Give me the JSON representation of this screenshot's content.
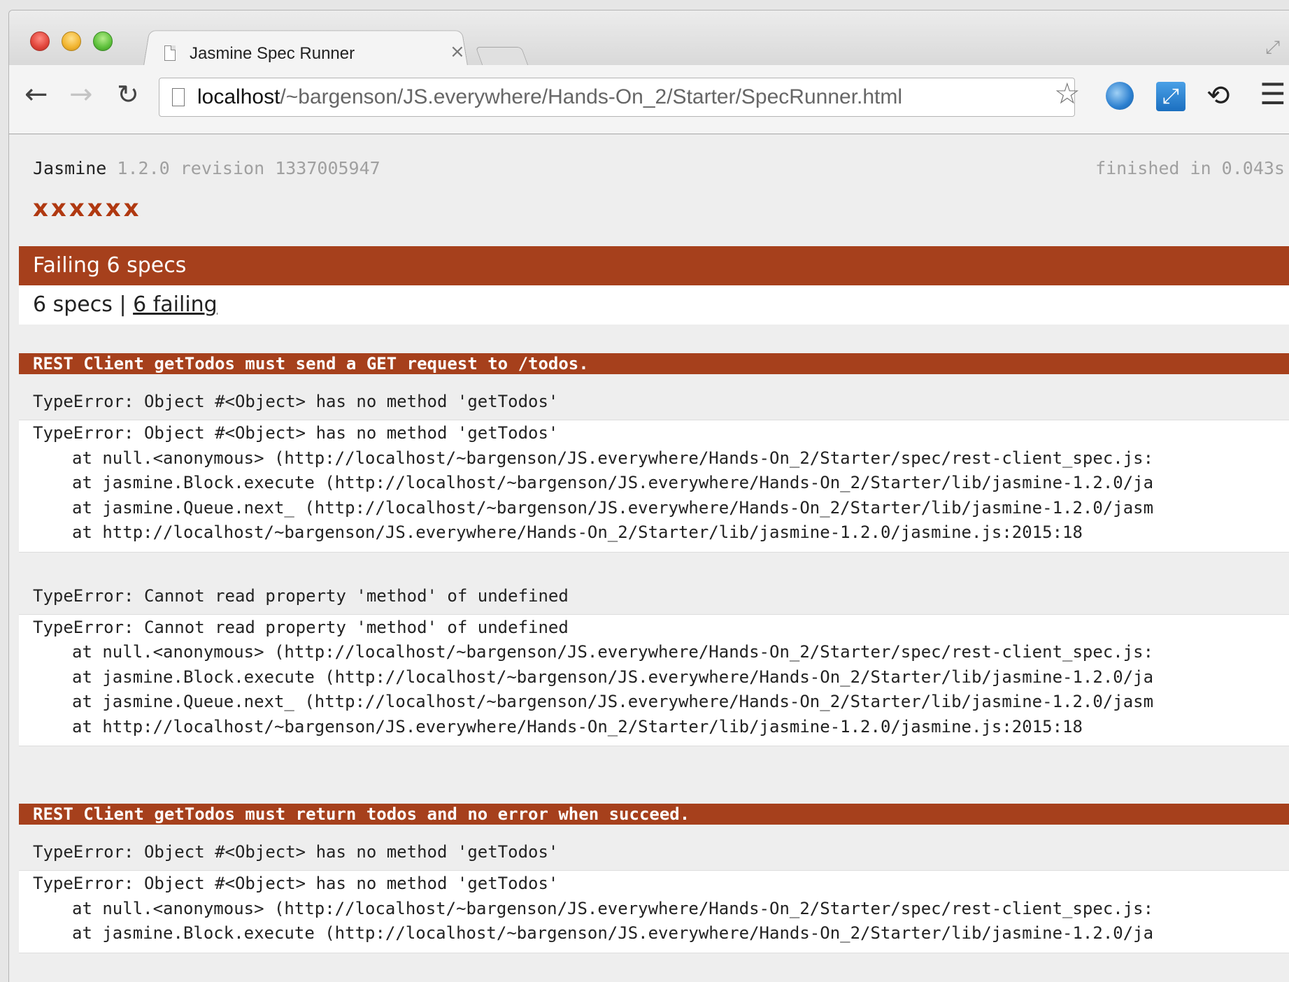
{
  "browser": {
    "tab_title": "Jasmine Spec Runner",
    "tab_close": "×",
    "url_host": "localhost",
    "url_path": "/~bargenson/JS.everywhere/Hands-On_2/Starter/SpecRunner.html",
    "icons": [
      "back-arrow-icon",
      "forward-arrow-icon",
      "reload-icon",
      "page-icon",
      "star-icon",
      "globe-icon",
      "resize-icon",
      "sync-icon",
      "menu-icon"
    ]
  },
  "jasmine": {
    "name": "Jasmine",
    "version": "1.2.0 revision 1337005947",
    "duration": "finished in 0.043s",
    "symbols": "xxxxxx",
    "failing_label": "Failing 6 specs",
    "summary_specs": "6 specs",
    "summary_sep": "|",
    "summary_failing": "6 failing"
  },
  "specs": [
    {
      "header": "REST Client getTodos must send a GET request to /todos.",
      "errors": [
        {
          "message": "TypeError: Object #<Object> has no method 'getTodos'",
          "trace": [
            "TypeError: Object #<Object> has no method 'getTodos'",
            "at null.<anonymous> (http://localhost/~bargenson/JS.everywhere/Hands-On_2/Starter/spec/rest-client_spec.js:",
            "at jasmine.Block.execute (http://localhost/~bargenson/JS.everywhere/Hands-On_2/Starter/lib/jasmine-1.2.0/ja",
            "at jasmine.Queue.next_ (http://localhost/~bargenson/JS.everywhere/Hands-On_2/Starter/lib/jasmine-1.2.0/jasm",
            "at http://localhost/~bargenson/JS.everywhere/Hands-On_2/Starter/lib/jasmine-1.2.0/jasmine.js:2015:18"
          ]
        },
        {
          "message": "TypeError: Cannot read property 'method' of undefined",
          "trace": [
            "TypeError: Cannot read property 'method' of undefined",
            "at null.<anonymous> (http://localhost/~bargenson/JS.everywhere/Hands-On_2/Starter/spec/rest-client_spec.js:",
            "at jasmine.Block.execute (http://localhost/~bargenson/JS.everywhere/Hands-On_2/Starter/lib/jasmine-1.2.0/ja",
            "at jasmine.Queue.next_ (http://localhost/~bargenson/JS.everywhere/Hands-On_2/Starter/lib/jasmine-1.2.0/jasm",
            "at http://localhost/~bargenson/JS.everywhere/Hands-On_2/Starter/lib/jasmine-1.2.0/jasmine.js:2015:18"
          ]
        }
      ]
    },
    {
      "header": "REST Client getTodos must return todos and no error when succeed.",
      "errors": [
        {
          "message": "TypeError: Object #<Object> has no method 'getTodos'",
          "trace": [
            "TypeError: Object #<Object> has no method 'getTodos'",
            "at null.<anonymous> (http://localhost/~bargenson/JS.everywhere/Hands-On_2/Starter/spec/rest-client_spec.js:",
            "at jasmine.Block.execute (http://localhost/~bargenson/JS.everywhere/Hands-On_2/Starter/lib/jasmine-1.2.0/ja"
          ]
        }
      ]
    }
  ],
  "colors": {
    "failing_bar": "#a6401c",
    "symbol_red": "#b03911"
  }
}
